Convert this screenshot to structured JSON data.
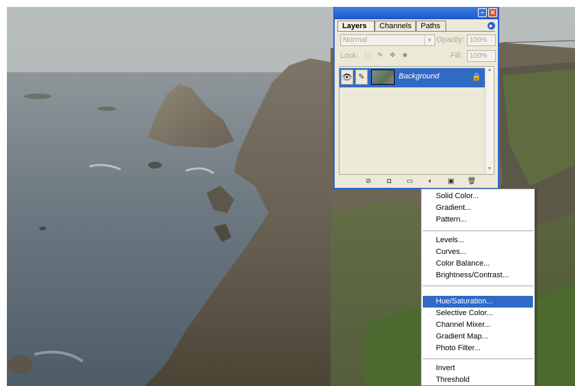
{
  "layers_panel": {
    "tabs": [
      "Layers",
      "Channels",
      "Paths"
    ],
    "active_tab": "Layers",
    "blend_mode": "Normal",
    "opacity_label": "Opacity:",
    "opacity_value": "100%",
    "lock_label": "Lock:",
    "fill_label": "Fill:",
    "fill_value": "100%",
    "layer": {
      "name": "Background",
      "visible": true,
      "locked": true
    }
  },
  "adjustment_menu": {
    "selected": "Hue/Saturation...",
    "items": [
      "Solid Color...",
      "Gradient...",
      "Pattern...",
      "Levels...",
      "Curves...",
      "Color Balance...",
      "Brightness/Contrast...",
      "Hue/Saturation...",
      "Selective Color...",
      "Channel Mixer...",
      "Gradient Map...",
      "Photo Filter...",
      "Invert",
      "Threshold"
    ]
  },
  "colors": {
    "selection": "#316ac5",
    "palette_bg": "#ece9d8",
    "titlebar": "#1e56c8"
  },
  "icons": [
    "eye-icon",
    "brush-icon",
    "link-icon",
    "fx-icon",
    "mask-icon",
    "folder-icon",
    "adjustment-layer-icon",
    "new-layer-icon",
    "trash-icon",
    "lock-icon"
  ]
}
